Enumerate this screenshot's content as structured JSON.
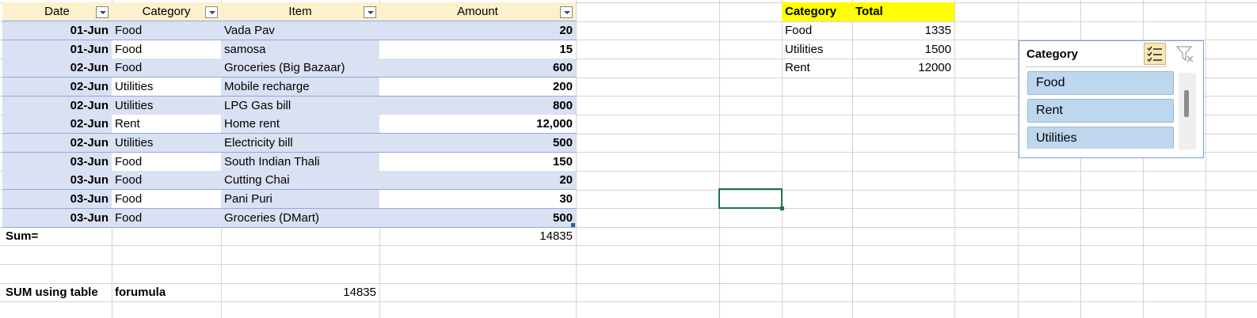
{
  "table": {
    "headers": [
      "Date",
      "Category",
      "Item",
      "Amount"
    ],
    "rows": [
      [
        "01-Jun",
        "Food",
        "Vada Pav",
        "20"
      ],
      [
        "01-Jun",
        "Food",
        "samosa",
        "15"
      ],
      [
        "02-Jun",
        "Food",
        "Groceries (Big Bazaar)",
        "600"
      ],
      [
        "02-Jun",
        "Utilities",
        "Mobile recharge",
        "200"
      ],
      [
        "02-Jun",
        "Utilities",
        "LPG Gas bill",
        "800"
      ],
      [
        "02-Jun",
        "Rent",
        "Home rent",
        "12,000"
      ],
      [
        "02-Jun",
        "Utilities",
        "Electricity bill",
        "500"
      ],
      [
        "03-Jun",
        "Food",
        "South Indian Thali",
        "150"
      ],
      [
        "03-Jun",
        "Food",
        "Cutting Chai",
        "20"
      ],
      [
        "03-Jun",
        "Food",
        "Pani Puri",
        "30"
      ],
      [
        "03-Jun",
        "Food",
        "Groceries (DMart)",
        "500"
      ]
    ]
  },
  "sum_row": {
    "label": "Sum=",
    "value": "14835"
  },
  "table_formula_row": {
    "label": "SUM using table",
    "label2": "forumula",
    "value": "14835"
  },
  "summary": {
    "headers": [
      "Category",
      "Total"
    ],
    "rows": [
      [
        "Food",
        "1335"
      ],
      [
        "Utilities",
        "1500"
      ],
      [
        "Rent",
        "12000"
      ]
    ]
  },
  "slicer": {
    "title": "Category",
    "items": [
      "Food",
      "Rent",
      "Utilities"
    ],
    "multiselect_icon": "multi-select-icon",
    "clear_icon": "clear-filter-icon"
  },
  "colors": {
    "header_fill": "#fdf0cc",
    "band_fill": "#d9e1f2",
    "summary_header_fill": "#ffff00",
    "slicer_item_fill": "#bdd7ee",
    "selection_border": "#217346"
  }
}
